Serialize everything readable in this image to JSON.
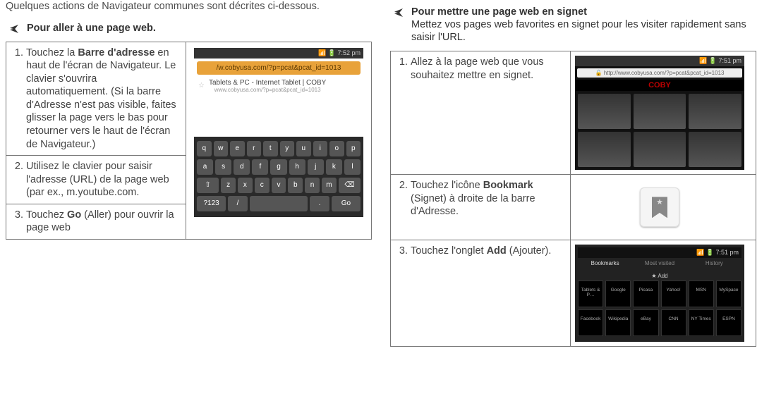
{
  "left": {
    "intro": "Quelques actions de Navigateur communes sont décrites ci-dessous.",
    "section_title": "Pour aller à une page web.",
    "step1_lead": "Touchez la ",
    "step1_bold": "Barre d'adresse",
    "step1_tail": " en haut de l'écran de Navigateur. Le clavier s'ouvrira automatiquement. (Si la barre d'Adresse n'est pas visible, faites glisser la page vers le bas pour retourner vers le haut de l'écran de Navigateur.)",
    "step2": "Utilisez le clavier pour saisir l'adresse (URL) de la page web (par ex., m.youtube.com.",
    "step3_lead": "Touchez ",
    "step3_bold": "Go",
    "step3_tail": " (Aller) pour ouvrir la page web",
    "mock": {
      "time": "7:52 pm",
      "url": "/w.cobyusa.com/?p=pcat&pcat_id=1013",
      "result_title": "Tablets & PC - Internet Tablet | COBY",
      "result_sub": "www.cobyusa.com/?p=pcat&pcat_id=1013",
      "kbd_rows": [
        [
          "q",
          "w",
          "e",
          "r",
          "t",
          "y",
          "u",
          "i",
          "o",
          "p"
        ],
        [
          "a",
          "s",
          "d",
          "f",
          "g",
          "h",
          "j",
          "k",
          "l"
        ],
        [
          "⇧",
          "z",
          "x",
          "c",
          "v",
          "b",
          "n",
          "m",
          "⌫"
        ]
      ],
      "kbd_bottom": {
        "sym": "?123",
        "slash": "/",
        "space": " ",
        "dot": ".",
        "go": "Go"
      }
    }
  },
  "right": {
    "section_title": "Pour mettre une page web en signet",
    "section_sub": "Mettez vos pages web favorites en signet pour les visiter rapidement sans saisir l'URL.",
    "step1": "Allez à la page web que vous souhaitez mettre en signet.",
    "step2_lead": "Touchez l'icône ",
    "step2_bold": "Bookmark",
    "step2_tail": " (Signet) à droite de la barre d'Adresse.",
    "step3_lead": "Touchez l'onglet ",
    "step3_bold": "Add",
    "step3_tail": " (Ajouter).",
    "mock_page": {
      "time": "7:51 pm",
      "url": "http://www.cobyusa.com/?p=pcat&pcat_id=1013",
      "brand": "COBY"
    },
    "mock_grid": {
      "time": "7:51 pm",
      "tab_bookmarks": "Bookmarks",
      "tab_most": "Most visited",
      "tab_history": "History",
      "add_label": "★ Add",
      "cells": [
        "Tablets & P…",
        "Google",
        "Picasa",
        "Yahoo!",
        "MSN",
        "MySpace",
        "Facebook",
        "Wikipedia",
        "eBay",
        "CNN",
        "NY Times",
        "ESPN"
      ]
    }
  }
}
